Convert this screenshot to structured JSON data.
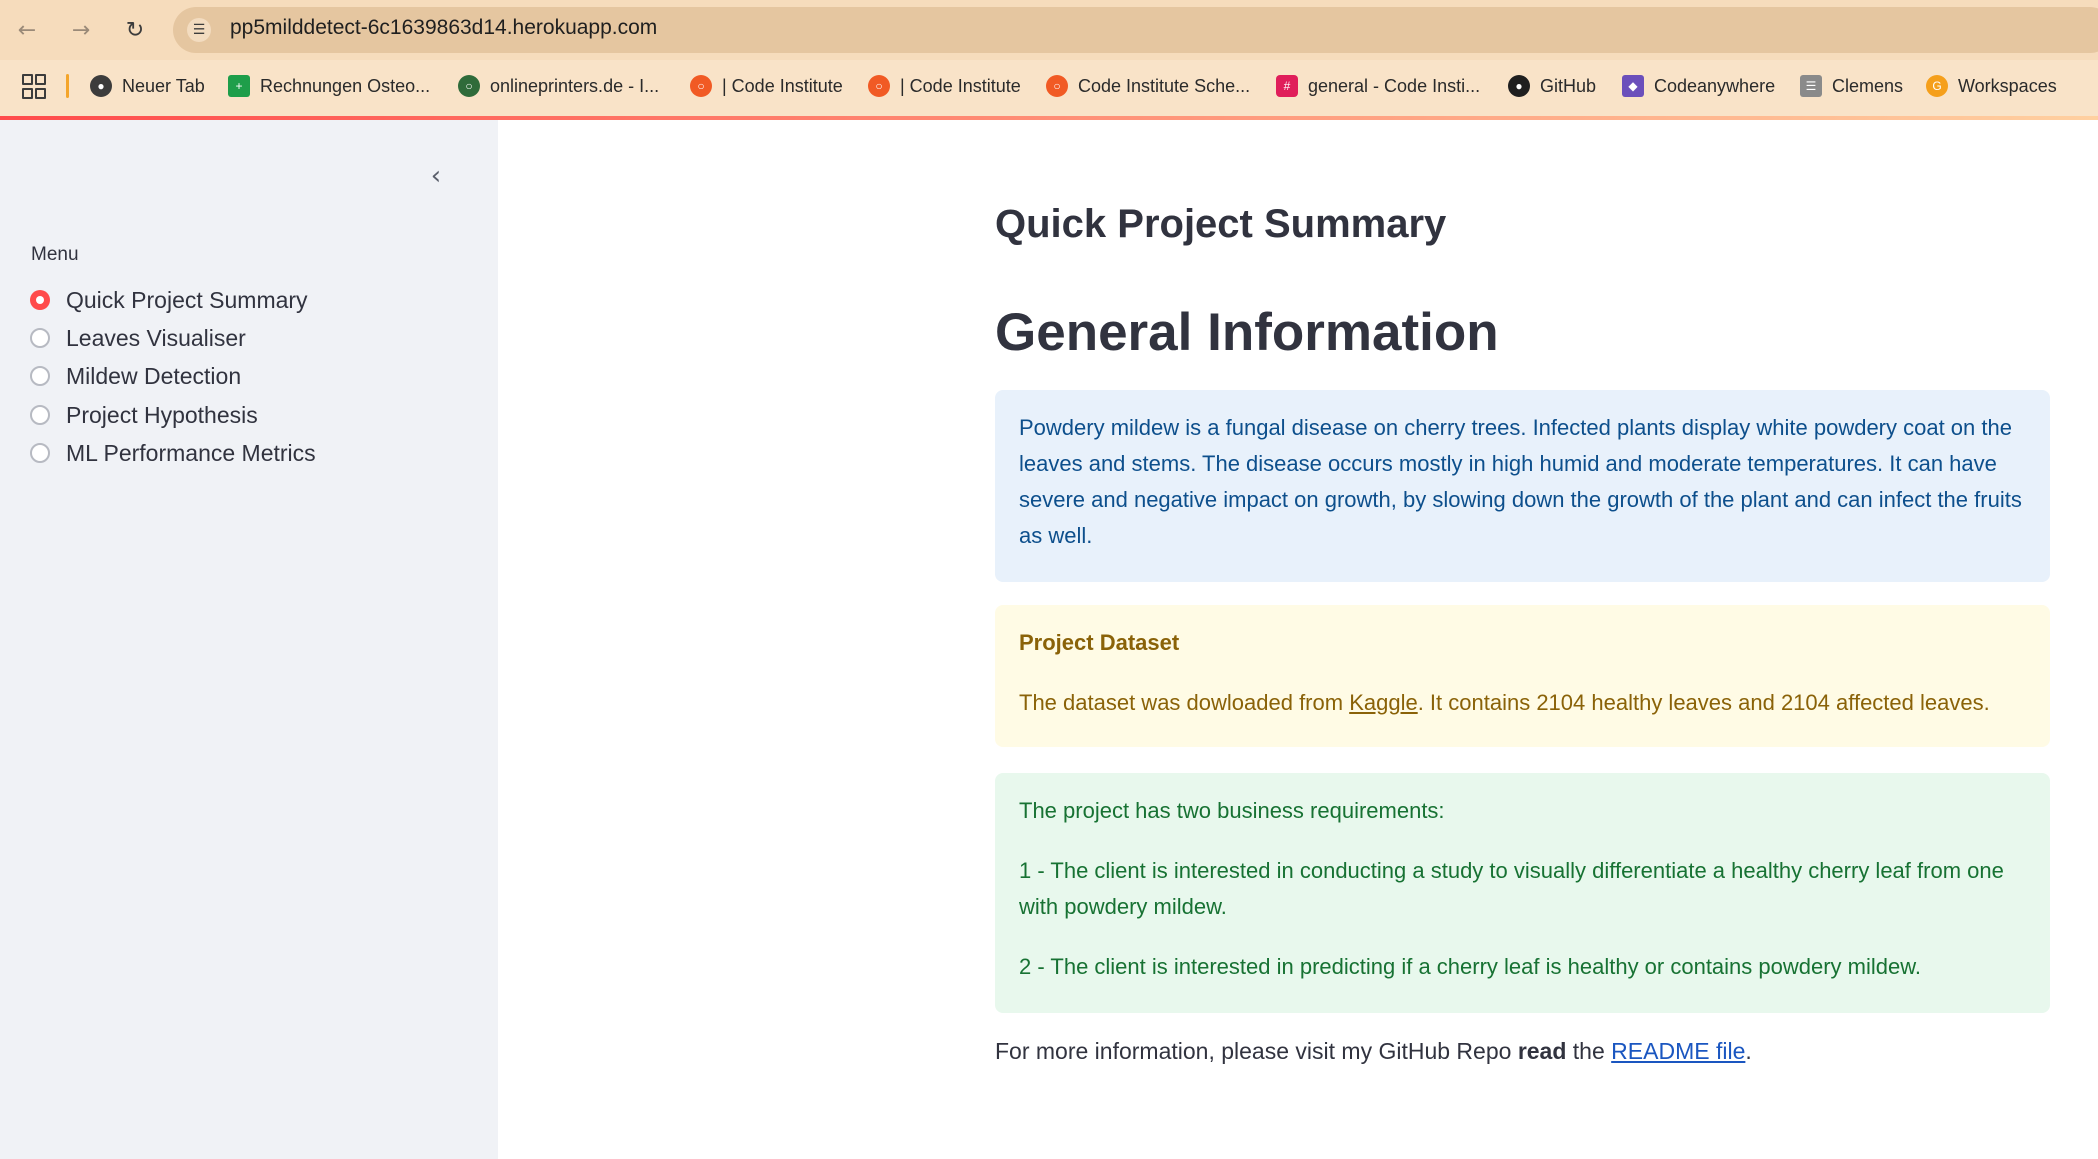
{
  "browser": {
    "url": "pp5milddetect-6c1639863d14.herokuapp.com",
    "bookmarks": [
      {
        "label": "Neuer Tab",
        "icon": "globe-icon"
      },
      {
        "label": "Rechnungen Osteo...",
        "icon": "sheets-icon"
      },
      {
        "label": "onlineprinters.de - I...",
        "icon": "onlineprinters-icon"
      },
      {
        "label": "| Code Institute",
        "icon": "code-institute-icon"
      },
      {
        "label": "| Code Institute",
        "icon": "code-institute-icon"
      },
      {
        "label": "Code Institute Sche...",
        "icon": "code-institute-icon"
      },
      {
        "label": "general - Code Insti...",
        "icon": "slack-icon"
      },
      {
        "label": "GitHub",
        "icon": "github-icon"
      },
      {
        "label": "Codeanywhere",
        "icon": "codeanywhere-icon"
      },
      {
        "label": "Clemens",
        "icon": "clemens-icon"
      },
      {
        "label": "Workspaces",
        "icon": "workspaces-icon"
      }
    ]
  },
  "sidebar": {
    "menu_label": "Menu",
    "items": [
      {
        "label": "Quick Project Summary",
        "selected": true
      },
      {
        "label": "Leaves Visualiser",
        "selected": false
      },
      {
        "label": "Mildew Detection",
        "selected": false
      },
      {
        "label": "Project Hypothesis",
        "selected": false
      },
      {
        "label": "ML Performance Metrics",
        "selected": false
      }
    ]
  },
  "main": {
    "subheader": "Quick Project Summary",
    "header": "General Information",
    "info_text": "Powdery mildew is a fungal disease on cherry trees. Infected plants display white powdery coat on the leaves and stems. The disease occurs mostly in high humid and moderate temperatures. It can have severe and negative impact on growth, by slowing down the growth of the plant and can infect the fruits as well.",
    "dataset": {
      "title": "Project Dataset",
      "text_before": "The dataset was dowloaded from ",
      "link": "Kaggle",
      "text_after": ". It contains 2104 healthy leaves and 2104 affected leaves."
    },
    "requirements": {
      "intro": "The project has two business requirements:",
      "req1": "1 - The client is interested in conducting a study to visually differentiate a healthy cherry leaf from one with powdery mildew.",
      "req2": "2 - The client is interested in predicting if a cherry leaf is healthy or contains powdery mildew."
    },
    "footer": {
      "text_before": "For more information, please visit my GitHub Repo ",
      "bold": "read",
      "text_mid": " the ",
      "link": "README file",
      "text_after": "."
    }
  },
  "colors": {
    "accent": "#ff4b4b",
    "info_bg": "#e8f1fb",
    "warn_bg": "#fffbe5",
    "success_bg": "#e8f8ed"
  }
}
